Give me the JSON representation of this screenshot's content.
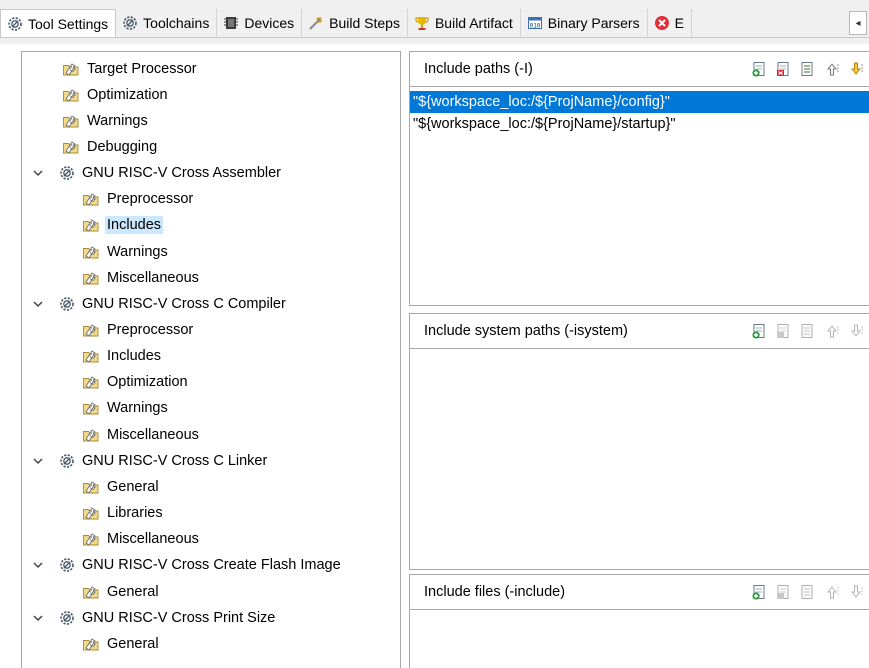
{
  "tabs": [
    {
      "label": "Tool Settings",
      "icon": "gear-tool-icon",
      "active": true
    },
    {
      "label": "Toolchains",
      "icon": "gear-tool-icon",
      "active": false
    },
    {
      "label": "Devices",
      "icon": "chip-icon",
      "active": false
    },
    {
      "label": "Build Steps",
      "icon": "build-steps-icon",
      "active": false
    },
    {
      "label": "Build Artifact",
      "icon": "trophy-icon",
      "active": false
    },
    {
      "label": "Binary Parsers",
      "icon": "binary-icon",
      "active": false
    },
    {
      "label": "E",
      "icon": "error-icon",
      "active": false
    }
  ],
  "tab_scroll_glyph": "◂",
  "tree": {
    "items": [
      {
        "label": "Target Processor",
        "level": 0,
        "kind": "page"
      },
      {
        "label": "Optimization",
        "level": 0,
        "kind": "page"
      },
      {
        "label": "Warnings",
        "level": 0,
        "kind": "page"
      },
      {
        "label": "Debugging",
        "level": 0,
        "kind": "page"
      },
      {
        "label": "GNU RISC-V Cross Assembler",
        "level": 0,
        "kind": "tool",
        "expanded": true
      },
      {
        "label": "Preprocessor",
        "level": 1,
        "kind": "page"
      },
      {
        "label": "Includes",
        "level": 1,
        "kind": "page",
        "selected": true
      },
      {
        "label": "Warnings",
        "level": 1,
        "kind": "page"
      },
      {
        "label": "Miscellaneous",
        "level": 1,
        "kind": "page"
      },
      {
        "label": "GNU RISC-V Cross C Compiler",
        "level": 0,
        "kind": "tool",
        "expanded": true
      },
      {
        "label": "Preprocessor",
        "level": 1,
        "kind": "page"
      },
      {
        "label": "Includes",
        "level": 1,
        "kind": "page"
      },
      {
        "label": "Optimization",
        "level": 1,
        "kind": "page"
      },
      {
        "label": "Warnings",
        "level": 1,
        "kind": "page"
      },
      {
        "label": "Miscellaneous",
        "level": 1,
        "kind": "page"
      },
      {
        "label": "GNU RISC-V Cross C Linker",
        "level": 0,
        "kind": "tool",
        "expanded": true
      },
      {
        "label": "General",
        "level": 1,
        "kind": "page"
      },
      {
        "label": "Libraries",
        "level": 1,
        "kind": "page"
      },
      {
        "label": "Miscellaneous",
        "level": 1,
        "kind": "page"
      },
      {
        "label": "GNU RISC-V Cross Create Flash Image",
        "level": 0,
        "kind": "tool",
        "expanded": true
      },
      {
        "label": "General",
        "level": 1,
        "kind": "page"
      },
      {
        "label": "GNU RISC-V Cross Print Size",
        "level": 0,
        "kind": "tool",
        "expanded": true
      },
      {
        "label": "General",
        "level": 1,
        "kind": "page"
      }
    ]
  },
  "panels": {
    "include_paths": {
      "title": "Include paths (-I)",
      "items": [
        "\"${workspace_loc:/${ProjName}/config}\"",
        "\"${workspace_loc:/${ProjName}/startup}\""
      ],
      "selected_index": 0
    },
    "include_system_paths": {
      "title": "Include system paths (-isystem)",
      "items": []
    },
    "include_files": {
      "title": "Include files (-include)",
      "items": []
    }
  },
  "toolbar_icons": [
    "add-icon",
    "delete-icon",
    "edit-icon",
    "move-up-icon",
    "move-down-icon"
  ],
  "colors": {
    "selection_blue": "#0078d7",
    "tree_selection": "#cce8ff",
    "tab_bar_bg": "#f0f0f0",
    "border": "#a8a8a8"
  }
}
